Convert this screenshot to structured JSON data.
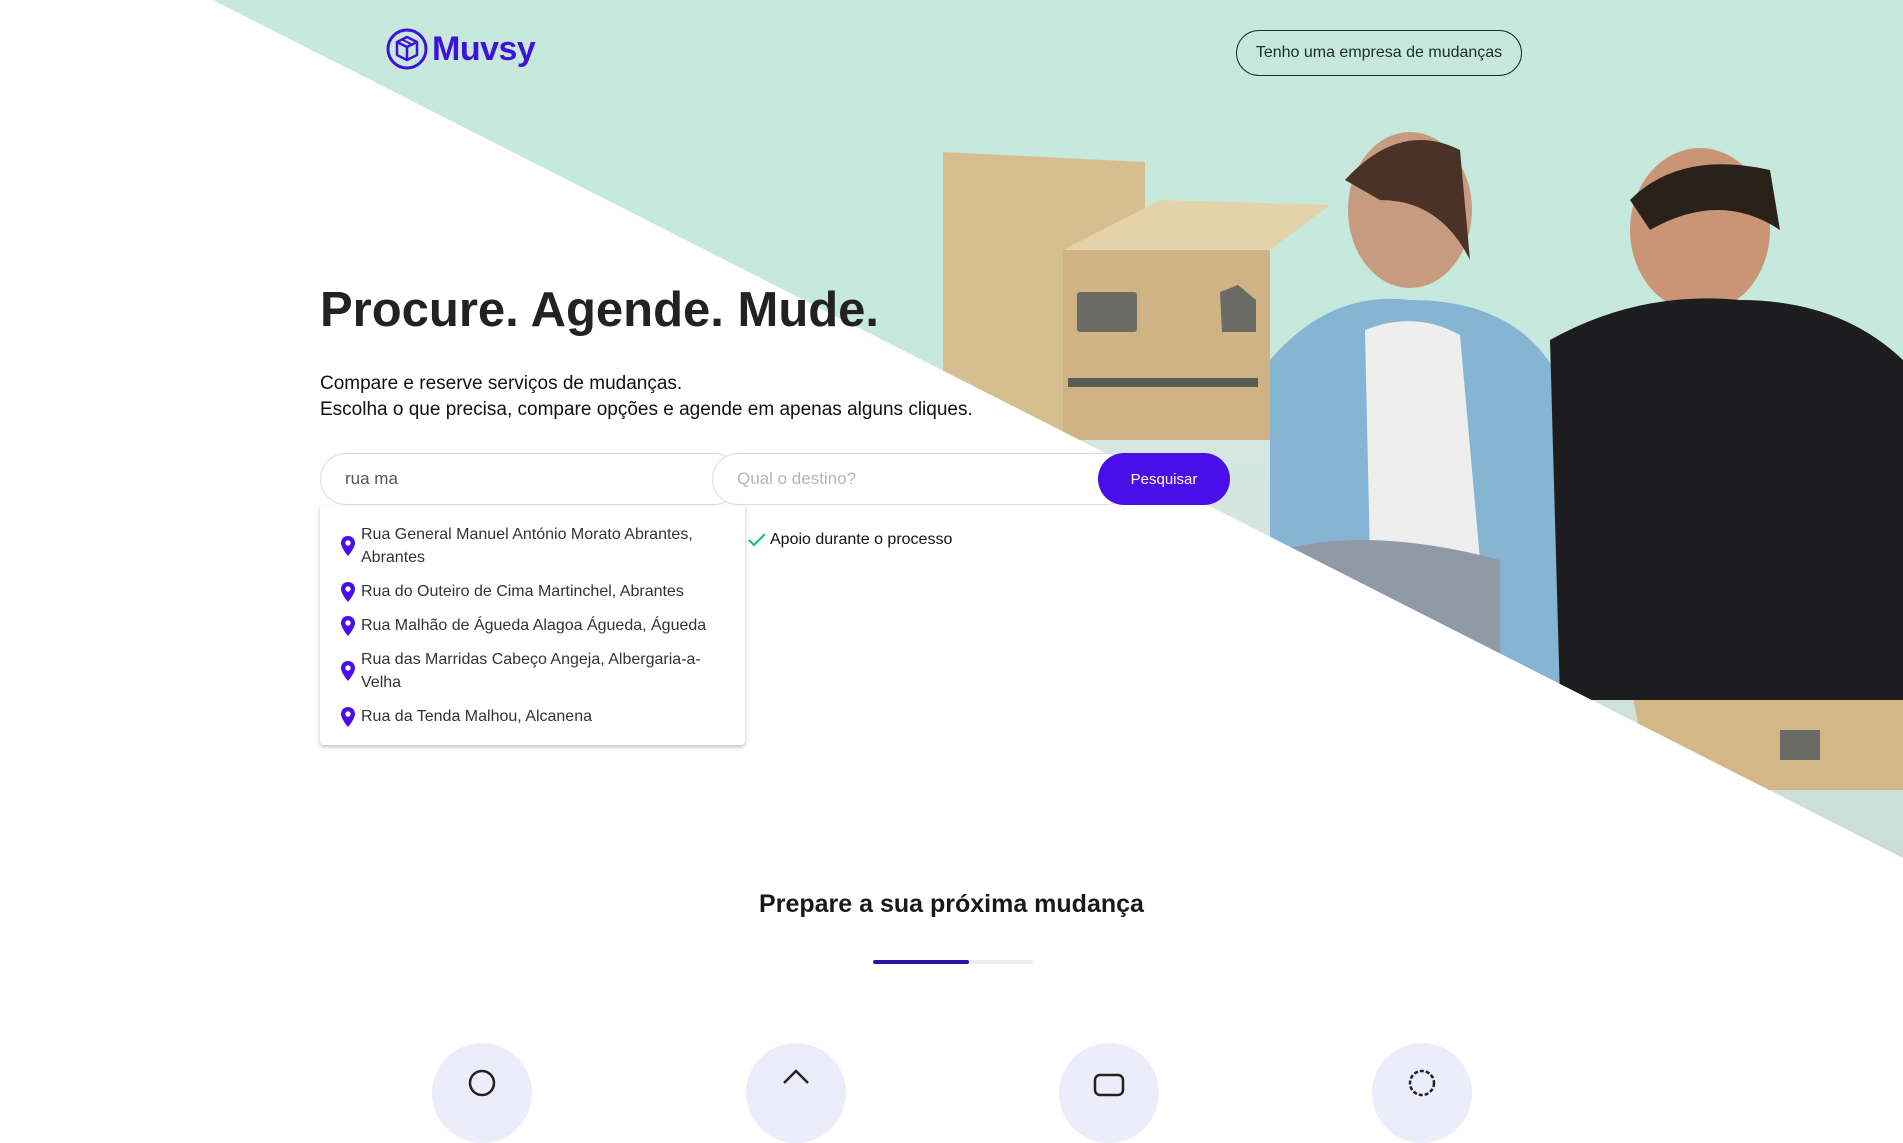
{
  "brand": {
    "name": "Muvsy",
    "color": "#3f12d9"
  },
  "header": {
    "company_button": "Tenho uma empresa de mudanças"
  },
  "hero": {
    "title": "Procure. Agende. Mude.",
    "subtitle_line1": "Compare e reserve serviços de mudanças.",
    "subtitle_line2": "Escolha o que precisa, compare opções e agende em apenas alguns cliques."
  },
  "search": {
    "origin_value": "rua ma",
    "destination_placeholder": "Qual o destino?",
    "button_label": "Pesquisar",
    "suggestions": [
      "Rua General Manuel António Morato Abrantes, Abrantes",
      "Rua do Outeiro de Cima Martinchel, Abrantes",
      "Rua Malhão de Águeda Alagoa Águeda, Águeda",
      "Rua das Marridas Cabeço Angeja, Albergaria-a-Velha",
      "Rua da Tenda Malhou, Alcanena"
    ]
  },
  "features": [
    {
      "label": "Apoio durante o processo",
      "icon": "check-icon"
    }
  ],
  "section": {
    "title": "Prepare a sua próxima mudança",
    "carousel_progress": 0.6
  },
  "colors": {
    "accent": "#4a0fe8",
    "mint": "#c6e8dd",
    "check": "#1fbf73",
    "progress": "#2c13a6"
  }
}
